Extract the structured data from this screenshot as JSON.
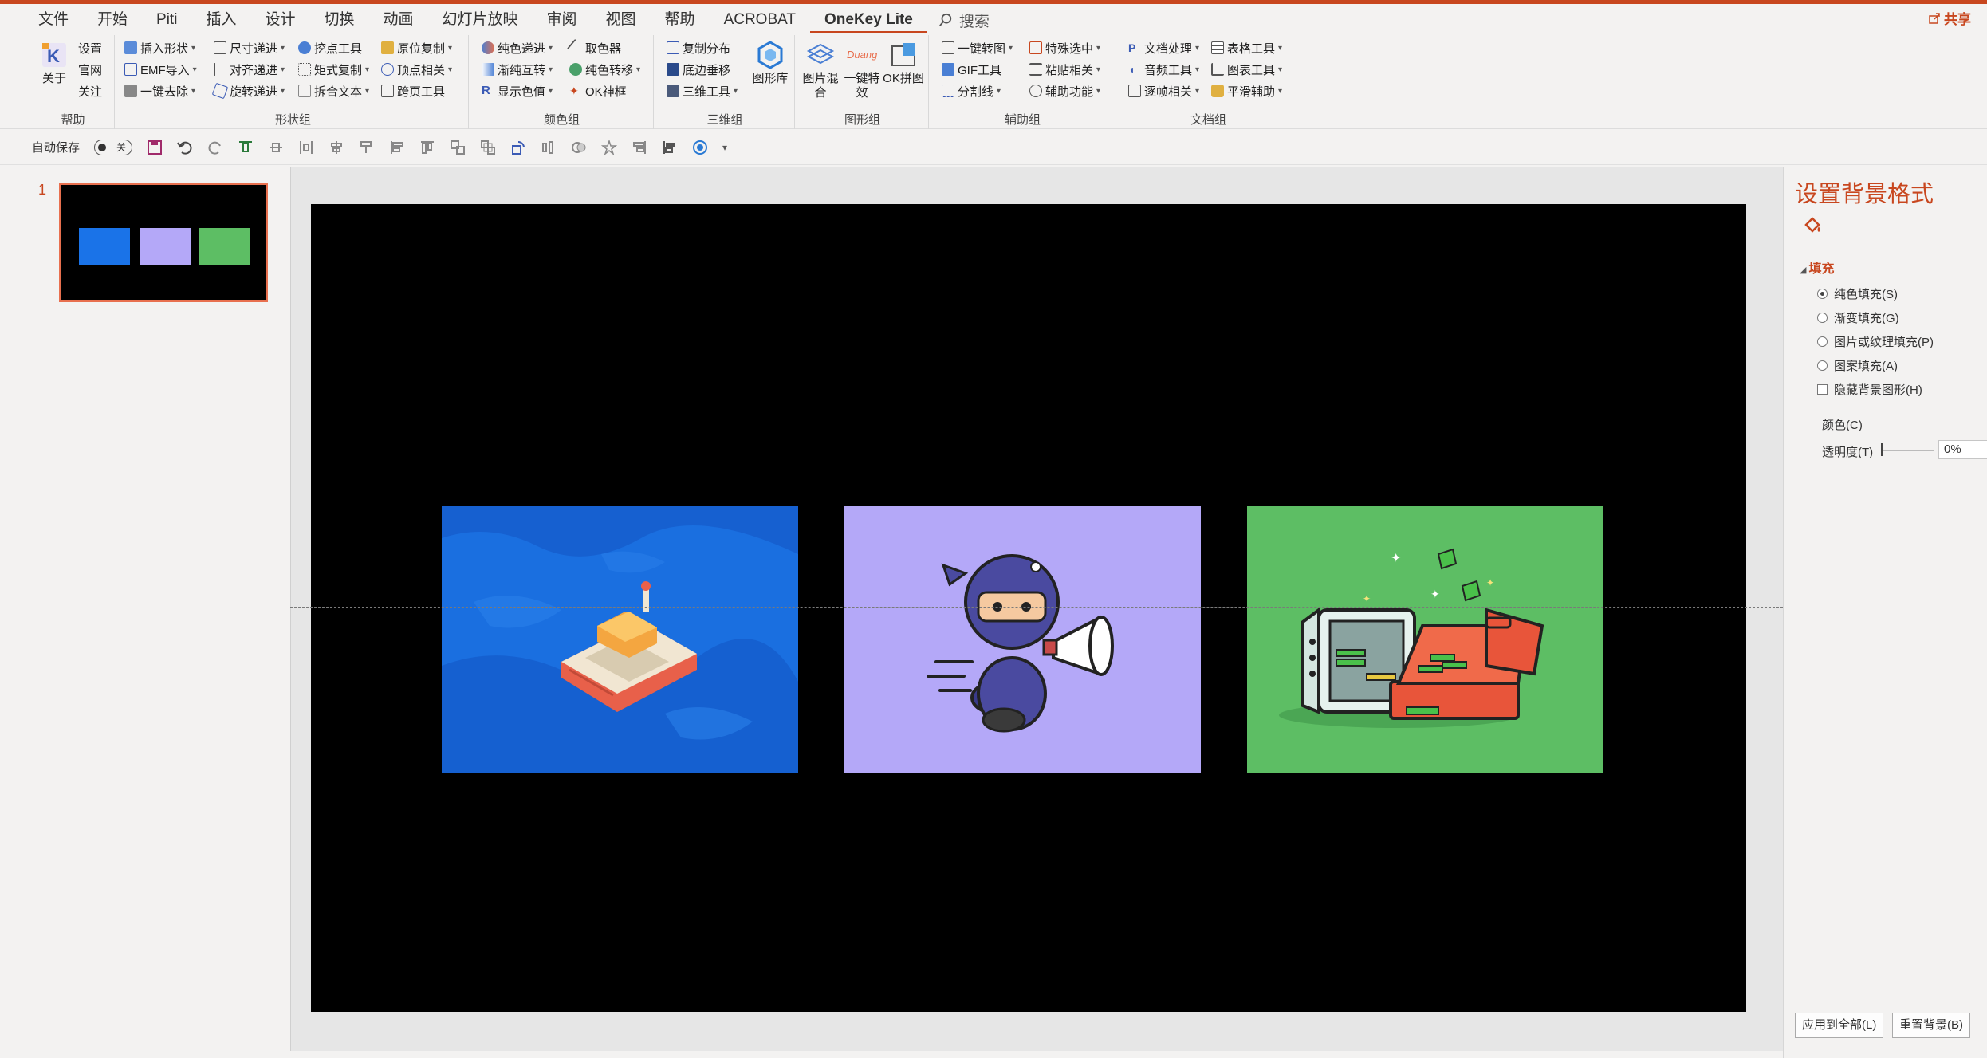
{
  "menu": {
    "items": [
      "文件",
      "开始",
      "Piti",
      "插入",
      "设计",
      "切换",
      "动画",
      "幻灯片放映",
      "审阅",
      "视图",
      "帮助",
      "ACROBAT",
      "OneKey Lite"
    ],
    "active": "OneKey Lite",
    "search_label": "搜索",
    "share_label": "共享"
  },
  "ribbon": {
    "help_group": {
      "label": "帮助",
      "about": "关于",
      "settings": "设置",
      "website": "官网",
      "follow": "关注"
    },
    "shape_group": {
      "label": "形状组",
      "col1": [
        "插入形状",
        "EMF导入",
        "一键去除"
      ],
      "col2": [
        "尺寸递进",
        "对齐递进",
        "旋转递进"
      ],
      "col3": [
        "挖点工具",
        "矩式复制",
        "拆合文本"
      ],
      "col4": [
        "原位复制",
        "顶点相关",
        "跨页工具"
      ]
    },
    "color_group": {
      "label": "颜色组",
      "col1": [
        "纯色递进",
        "渐纯互转",
        "显示色值"
      ],
      "col2": [
        "取色器",
        "纯色转移",
        "OK神框"
      ]
    },
    "threed_group": {
      "label": "三维组",
      "col1": [
        "复制分布",
        "底边垂移",
        "三维工具"
      ],
      "big": "图形库"
    },
    "graphic_group": {
      "label": "图形组",
      "btn1": "图片混合",
      "btn2": "一键特效",
      "btn3": "OK拼图",
      "duang": "Duang"
    },
    "assist_group": {
      "label": "辅助组",
      "col1": [
        "一键转图",
        "GIF工具",
        "分割线"
      ],
      "col2": [
        "特殊选中",
        "粘贴相关",
        "辅助功能"
      ]
    },
    "doc_group": {
      "label": "文档组",
      "col1": [
        "文档处理",
        "音频工具",
        "逐帧相关"
      ],
      "col2": [
        "表格工具",
        "图表工具",
        "平滑辅助"
      ]
    }
  },
  "qat": {
    "autosave_label": "自动保存",
    "toggle_state": "关"
  },
  "thumbnails": {
    "slide_number": "1"
  },
  "format_pane": {
    "title": "设置背景格式",
    "section": "填充",
    "options": [
      "纯色填充(S)",
      "渐变填充(G)",
      "图片或纹理填充(P)",
      "图案填充(A)"
    ],
    "selected_option": "纯色填充(S)",
    "hide_bg_label": "隐藏背景图形(H)",
    "color_label": "颜色(C)",
    "transparency_label": "透明度(T)",
    "transparency_value": "0%",
    "apply_all_button": "应用到全部(L)",
    "reset_button": "重置背景(B)"
  },
  "colors": {
    "accent": "#c8471f",
    "slide_bg": "#000000",
    "pic1_bg": "#1a73e8",
    "pic2_bg": "#b4a8f8",
    "pic3_bg": "#5dbe64"
  }
}
